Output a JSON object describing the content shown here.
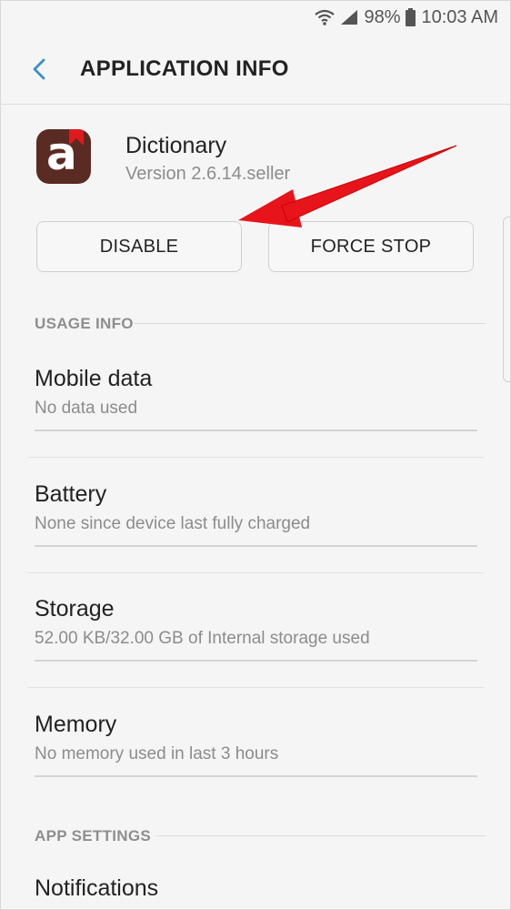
{
  "status_bar": {
    "battery_percent": "98%",
    "time": "10:03 AM",
    "icons": [
      "wifi-icon",
      "signal-icon",
      "battery-icon"
    ]
  },
  "app_bar": {
    "back_icon": "chevron-left-icon",
    "title": "APPLICATION INFO"
  },
  "app": {
    "name": "Dictionary",
    "version": "Version 2.6.14.seller",
    "icon_letter": "a",
    "icon_color": "#5a2b22",
    "icon_ribbon_color": "#e0191e"
  },
  "buttons": {
    "disable": "DISABLE",
    "force_stop": "FORCE STOP"
  },
  "usage_info": {
    "header": "USAGE INFO",
    "items": [
      {
        "title": "Mobile data",
        "subtitle": "No data used"
      },
      {
        "title": "Battery",
        "subtitle": "None since device last fully charged"
      },
      {
        "title": "Storage",
        "subtitle": "52.00 KB/32.00 GB of Internal storage used"
      },
      {
        "title": "Memory",
        "subtitle": "No memory used in last 3 hours"
      }
    ]
  },
  "app_settings": {
    "header": "APP SETTINGS",
    "items": [
      {
        "title": "Notifications"
      }
    ]
  },
  "annotation": {
    "arrow_color": "#e8141b"
  },
  "colors": {
    "accent": "#3f8fc4",
    "background": "#f5f5f5"
  }
}
